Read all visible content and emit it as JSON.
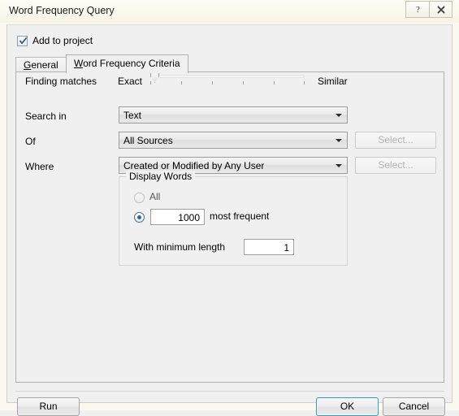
{
  "window": {
    "title": "Word Frequency Query",
    "help_icon": "question-mark-icon",
    "close_icon": "close-x-icon"
  },
  "add_to_project": {
    "label": "Add to project",
    "checked": true
  },
  "tabs": [
    {
      "label": "General",
      "accel": "G",
      "active": false
    },
    {
      "label": "Word Frequency Criteria",
      "accel": "W",
      "active": true
    }
  ],
  "finding_matches": {
    "label": "Finding matches",
    "min_label": "Exact",
    "max_label": "Similar",
    "value": 0,
    "ticks": 6
  },
  "fields": {
    "search_in": {
      "label": "Search in",
      "value": "Text"
    },
    "of": {
      "label": "Of",
      "value": "All Sources",
      "select_button": "Select..."
    },
    "where": {
      "label": "Where",
      "value": "Created or Modified by Any User",
      "select_button": "Select..."
    }
  },
  "display_words": {
    "legend": "Display Words",
    "all_label": "All",
    "all_selected": false,
    "most_frequent_selected": true,
    "most_frequent_value": "1000",
    "most_frequent_label": "most frequent",
    "min_length_label": "With minimum length",
    "min_length_value": "1"
  },
  "footer": {
    "run": "Run",
    "ok": "OK",
    "cancel": "Cancel"
  },
  "colors": {
    "accent": "#2a6ca8",
    "default_button_border": "#3c9bbf",
    "titlebar": "#fbf9ee",
    "dialog_bg": "#f0f0f0"
  }
}
